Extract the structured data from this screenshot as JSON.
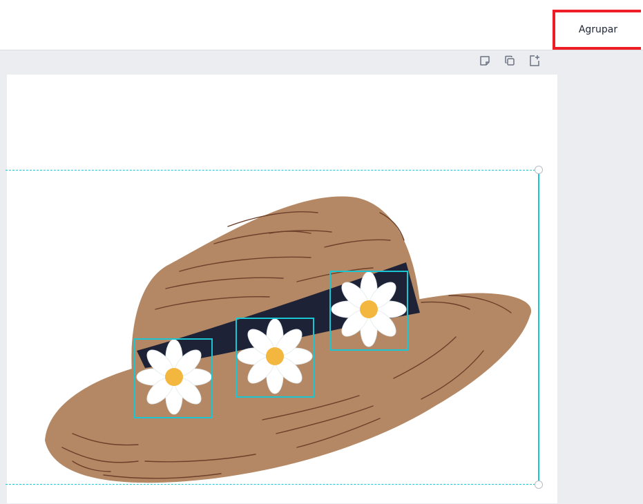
{
  "toolbar": {
    "group_label": "Agrupar",
    "highlight_color": "#ee1c24"
  },
  "page_tools": [
    {
      "icon": "note-icon"
    },
    {
      "icon": "duplicate-icon"
    },
    {
      "icon": "add-page-icon"
    }
  ],
  "selection": {
    "color": "#19c6d3",
    "selected_elements": [
      {
        "name": "flower-1"
      },
      {
        "name": "flower-2"
      },
      {
        "name": "flower-3"
      }
    ]
  },
  "artwork": {
    "subject": "straw-hat-with-daisies",
    "colors": {
      "straw": "#b48864",
      "stroke": "#6b3f2a",
      "band": "#1e2237",
      "petal": "#ffffff",
      "center": "#f3b63f"
    }
  }
}
